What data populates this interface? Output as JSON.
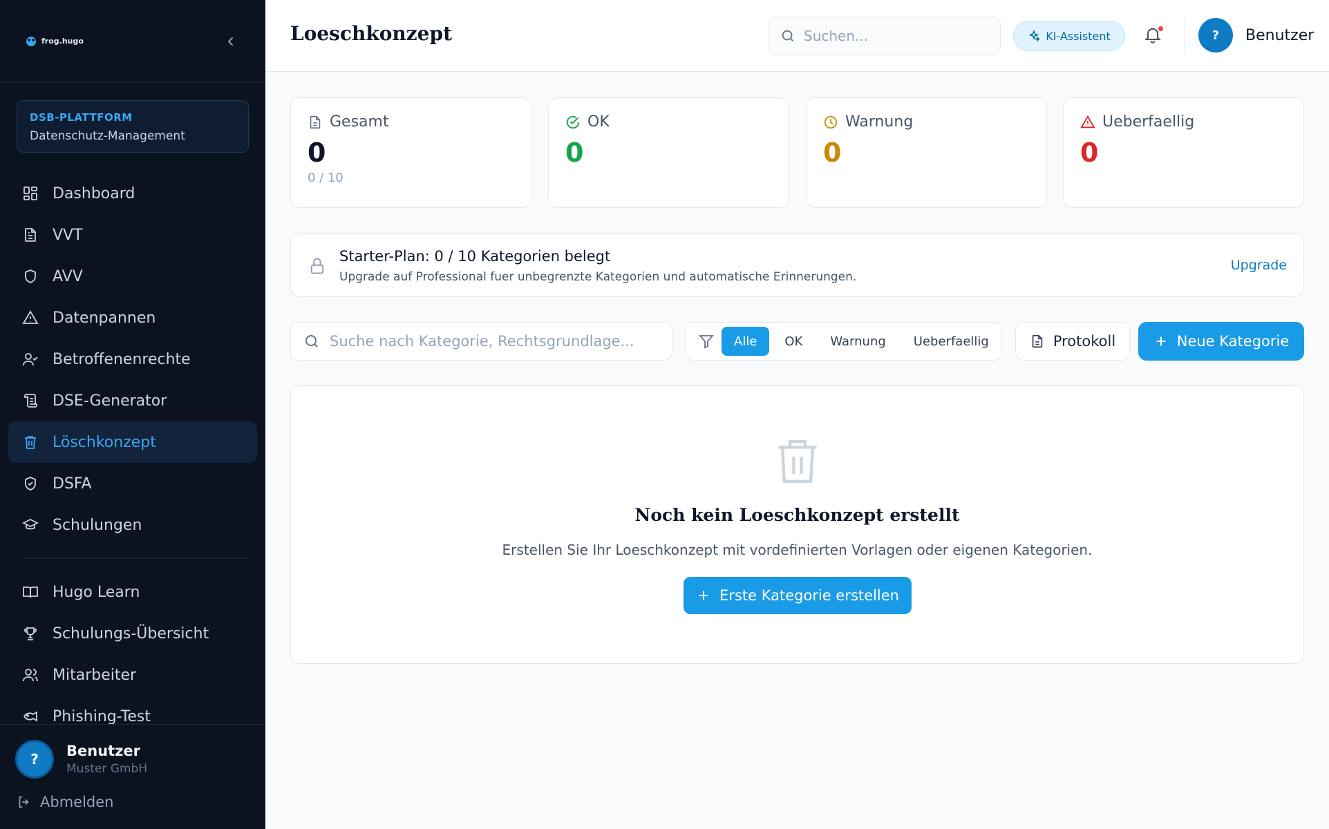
{
  "sidebar": {
    "logo_text": "frog.hugo",
    "platform": {
      "title": "DSB-PLATTFORM",
      "subtitle": "Datenschutz-Management"
    },
    "items": [
      {
        "label": "Dashboard",
        "icon": "grid-icon"
      },
      {
        "label": "VVT",
        "icon": "document-icon"
      },
      {
        "label": "AVV",
        "icon": "shield-icon"
      },
      {
        "label": "Datenpannen",
        "icon": "warning-icon"
      },
      {
        "label": "Betroffenenrechte",
        "icon": "user-check-icon"
      },
      {
        "label": "DSE-Generator",
        "icon": "scroll-icon"
      },
      {
        "label": "Löschkonzept",
        "icon": "trash-icon",
        "active": true
      },
      {
        "label": "DSFA",
        "icon": "shield-check-icon"
      },
      {
        "label": "Schulungen",
        "icon": "graduation-cap-icon"
      }
    ],
    "items2": [
      {
        "label": "Hugo Learn",
        "icon": "book-icon"
      },
      {
        "label": "Schulungs-Übersicht",
        "icon": "trophy-icon"
      },
      {
        "label": "Mitarbeiter",
        "icon": "users-icon"
      },
      {
        "label": "Phishing-Test",
        "icon": "fish-icon"
      }
    ],
    "user": {
      "avatar": "?",
      "name": "Benutzer",
      "org": "Muster GmbH"
    },
    "logout": "Abmelden"
  },
  "header": {
    "title": "Loeschkonzept",
    "search_placeholder": "Suchen...",
    "ki_label": "KI-Assistent",
    "user_avatar": "?",
    "user_name": "Benutzer"
  },
  "stats": [
    {
      "label": "Gesamt",
      "value": "0",
      "sub": "0 / 10",
      "color": "#0f172a",
      "icon": "document-icon"
    },
    {
      "label": "OK",
      "value": "0",
      "sub": "",
      "color": "#16a34a",
      "icon": "check-circle-icon"
    },
    {
      "label": "Warnung",
      "value": "0",
      "sub": "",
      "color": "#ca8a04",
      "icon": "clock-icon"
    },
    {
      "label": "Ueberfaellig",
      "value": "0",
      "sub": "",
      "color": "#dc2626",
      "icon": "alert-triangle-icon"
    }
  ],
  "plan": {
    "title": "Starter-Plan: 0 / 10 Kategorien belegt",
    "description": "Upgrade auf Professional fuer unbegrenzte Kategorien und automatische Erinnerungen.",
    "upgrade": "Upgrade"
  },
  "toolbar": {
    "search_placeholder": "Suche nach Kategorie, Rechtsgrundlage...",
    "filters": [
      "Alle",
      "OK",
      "Warnung",
      "Ueberfaellig"
    ],
    "active_filter": "Alle",
    "protokoll": "Protokoll",
    "new_category": "Neue Kategorie"
  },
  "empty": {
    "title": "Noch kein Loeschkonzept erstellt",
    "description": "Erstellen Sie Ihr Loeschkonzept mit vordefinierten Vorlagen oder eigenen Kategorien.",
    "button": "Erste Kategorie erstellen"
  },
  "colors": {
    "accent": "#1a9be6",
    "sidebar_bg": "#0b1220",
    "active_text": "#38a8f0"
  }
}
